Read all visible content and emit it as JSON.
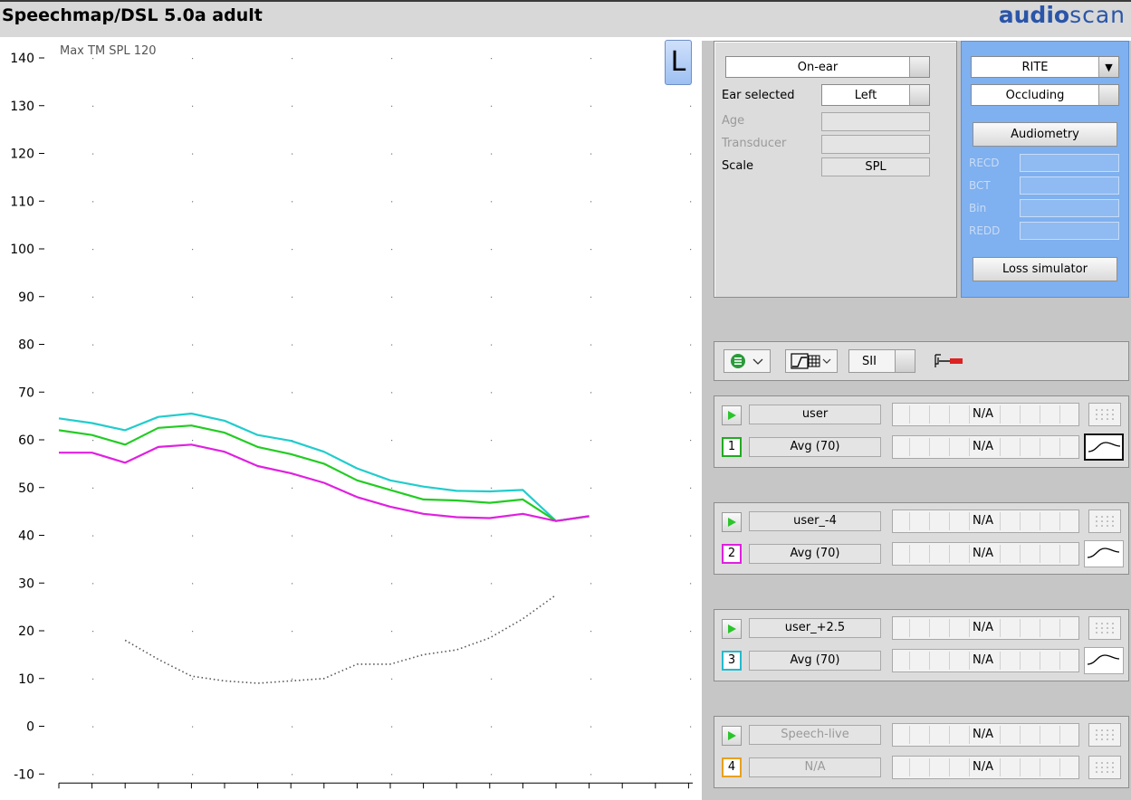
{
  "window": {
    "title": "Speechmap/DSL 5.0a adult",
    "brand_bold": "audio",
    "brand_light": "scan"
  },
  "chart_data": {
    "type": "line",
    "annotation": "Max TM SPL 120",
    "ylim": [
      -10,
      140
    ],
    "yticks": [
      -10,
      0,
      10,
      20,
      30,
      40,
      50,
      60,
      70,
      80,
      90,
      100,
      110,
      120,
      130,
      140
    ],
    "xlabel": "",
    "ylabel": "",
    "grid": "dotted",
    "x": [
      200,
      250,
      315,
      400,
      500,
      630,
      800,
      1000,
      1250,
      1600,
      2000,
      2500,
      3150,
      4000,
      5000,
      6300,
      8000
    ],
    "series": [
      {
        "color": "#22cccc",
        "values": [
          64.5,
          63.5,
          62,
          64.8,
          65.5,
          64,
          61,
          59.8,
          57.5,
          54,
          51.5,
          50.2,
          49.3,
          49.2,
          49.5,
          43,
          44
        ]
      },
      {
        "color": "#22cc22",
        "values": [
          62,
          61,
          59,
          62.5,
          63,
          61.5,
          58.5,
          57,
          55,
          51.5,
          49.5,
          47.5,
          47.3,
          46.8,
          47.5,
          43,
          44
        ]
      },
      {
        "color": "#e020e0",
        "values": [
          57.3,
          57.3,
          55.2,
          58.5,
          59,
          57.5,
          54.5,
          53,
          51,
          48,
          46,
          44.5,
          43.8,
          43.6,
          44.5,
          43,
          44
        ]
      },
      {
        "color": "#555555",
        "dashed": true,
        "values": [
          null,
          null,
          18,
          14,
          10.5,
          9.5,
          9,
          9.5,
          10,
          13,
          13,
          15,
          16,
          18.5,
          22.5,
          27.5,
          null
        ]
      }
    ]
  },
  "ear_button": "L",
  "settings": {
    "mode": "On-ear",
    "ear_selected_label": "Ear selected",
    "ear_selected_value": "Left",
    "age_label": "Age",
    "transducer_label": "Transducer",
    "scale_label": "Scale",
    "scale_value": "SPL"
  },
  "instrument": {
    "style": "RITE",
    "vent": "Occluding",
    "audiometry_button": "Audiometry",
    "recd_label": "RECD",
    "bct_label": "BCT",
    "bin_label": "Bin",
    "redd_label": "REDD",
    "loss_sim_button": "Loss simulator"
  },
  "toolbar": {
    "sii_label": "SII"
  },
  "sessions": [
    {
      "number": "1",
      "color": "#22aa22",
      "stimulus": "user",
      "level": "Avg (70)",
      "value1": "N/A",
      "value2": "N/A",
      "selected": true,
      "dim": false
    },
    {
      "number": "2",
      "color": "#e020e0",
      "stimulus": "user_-4",
      "level": "Avg (70)",
      "value1": "N/A",
      "value2": "N/A",
      "selected": false,
      "dim": false
    },
    {
      "number": "3",
      "color": "#22bbcc",
      "stimulus": "user_+2.5",
      "level": "Avg (70)",
      "value1": "N/A",
      "value2": "N/A",
      "selected": false,
      "dim": false
    },
    {
      "number": "4",
      "color": "#e8a020",
      "stimulus": "Speech-live",
      "level": "N/A",
      "value1": "N/A",
      "value2": "N/A",
      "selected": false,
      "dim": true
    }
  ],
  "icons": {
    "play": "play-icon",
    "curve": "response-curve-icon",
    "grid": "dotted-grid-icon",
    "dropdown": "triangle-down-icon"
  }
}
